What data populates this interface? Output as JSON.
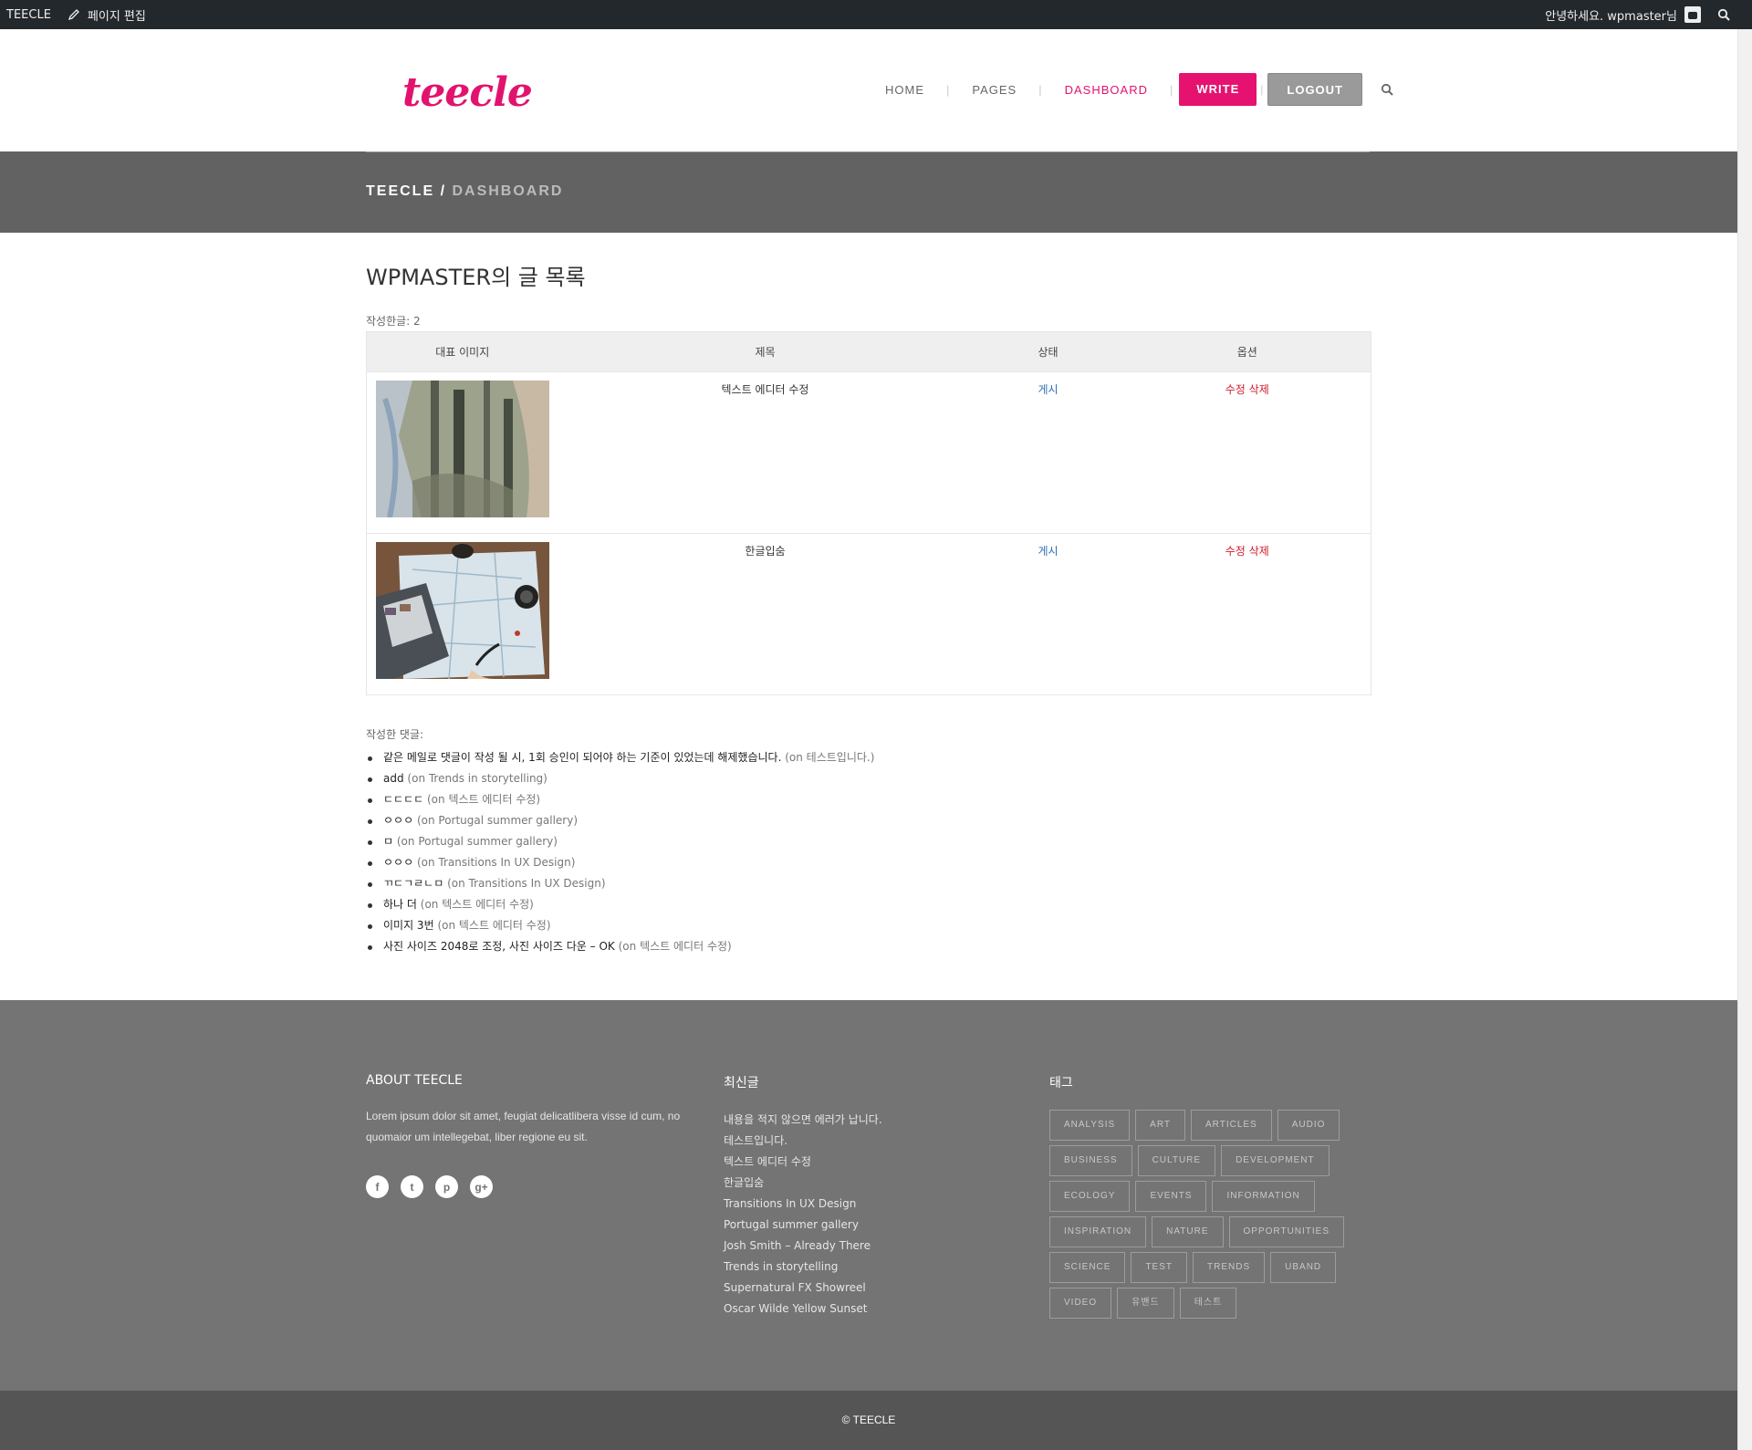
{
  "adminbar": {
    "site_name": "TEECLE",
    "edit_page": "페이지 편집",
    "greeting": "안녕하세요. wpmaster님"
  },
  "header": {
    "logo": "teecle",
    "nav": [
      "HOME",
      "PAGES",
      "DASHBOARD"
    ],
    "write_label": "WRITE",
    "logout_label": "LOGOUT",
    "active_color": "#e2136e"
  },
  "breadcrumb": {
    "site": "TEECLE",
    "separator": " / ",
    "current": "DASHBOARD"
  },
  "main": {
    "title": "WPMASTER의 글 목록",
    "post_count": "작성한글: 2",
    "table": {
      "headers": [
        "대표 이미지",
        "제목",
        "상태",
        "옵션"
      ],
      "rows": [
        {
          "title": "텍스트 에디터 수정",
          "status": "게시",
          "edit": "수정",
          "delete": "삭제",
          "image": "forest-photo"
        },
        {
          "title": "한글입숨",
          "status": "게시",
          "edit": "수정",
          "delete": "삭제",
          "image": "map-desk-photo"
        }
      ]
    },
    "comments_label": "작성한 댓글:",
    "comments": [
      {
        "text": "같은 메일로 댓글이 작성 될 시, 1회 승인이 되어야 하는 기준이 있었는데 해제했습니다.",
        "on": "(on 테스트입니다.)"
      },
      {
        "text": "add",
        "on": "(on Trends in storytelling)"
      },
      {
        "text": "ㄷㄷㄷㄷ",
        "on": "(on 텍스트 에디터 수정)"
      },
      {
        "text": "ㅇㅇㅇ",
        "on": "(on Portugal summer gallery)"
      },
      {
        "text": "ㅁ",
        "on": "(on Portugal summer gallery)"
      },
      {
        "text": "ㅇㅇㅇ",
        "on": "(on Transitions In UX Design)"
      },
      {
        "text": "ㄲㄷㄱㄹㄴㅁ",
        "on": "(on Transitions In UX Design)"
      },
      {
        "text": "하나 더",
        "on": "(on 텍스트 에디터 수정)"
      },
      {
        "text": "이미지 3번",
        "on": "(on 텍스트 에디터 수정)"
      },
      {
        "text": "사진 사이즈 2048로 조정, 사진 사이즈 다운 – OK",
        "on": "(on 텍스트 에디터 수정)"
      }
    ]
  },
  "footer": {
    "about_title": "ABOUT TEECLE",
    "about_text": "Lorem ipsum dolor sit amet, feugiat delicatlibera visse id cum, no quomaior um intellegebat, liber regione eu sit.",
    "social": [
      {
        "icon": "facebook-icon",
        "glyph": "f"
      },
      {
        "icon": "twitter-icon",
        "glyph": "t"
      },
      {
        "icon": "pinterest-icon",
        "glyph": "p"
      },
      {
        "icon": "google-plus-icon",
        "glyph": "g+"
      }
    ],
    "recent_title": "최신글",
    "recent": [
      "내용을 적지 않으면 에러가 납니다.",
      "테스트입니다.",
      "텍스트 에디터 수정",
      "한글입숨",
      "Transitions In UX Design",
      "Portugal summer gallery",
      "Josh Smith – Already There",
      "Trends in storytelling",
      "Supernatural FX Showreel",
      "Oscar Wilde Yellow Sunset"
    ],
    "tags_title": "태그",
    "tags": [
      "ANALYSIS",
      "ART",
      "ARTICLES",
      "AUDIO",
      "BUSINESS",
      "CULTURE",
      "DEVELOPMENT",
      "ECOLOGY",
      "EVENTS",
      "INFORMATION",
      "INSPIRATION",
      "NATURE",
      "OPPORTUNITIES",
      "SCIENCE",
      "TEST",
      "TRENDS",
      "UBAND",
      "VIDEO",
      "유밴드",
      "테스트"
    ],
    "copyright": "© TEECLE"
  }
}
